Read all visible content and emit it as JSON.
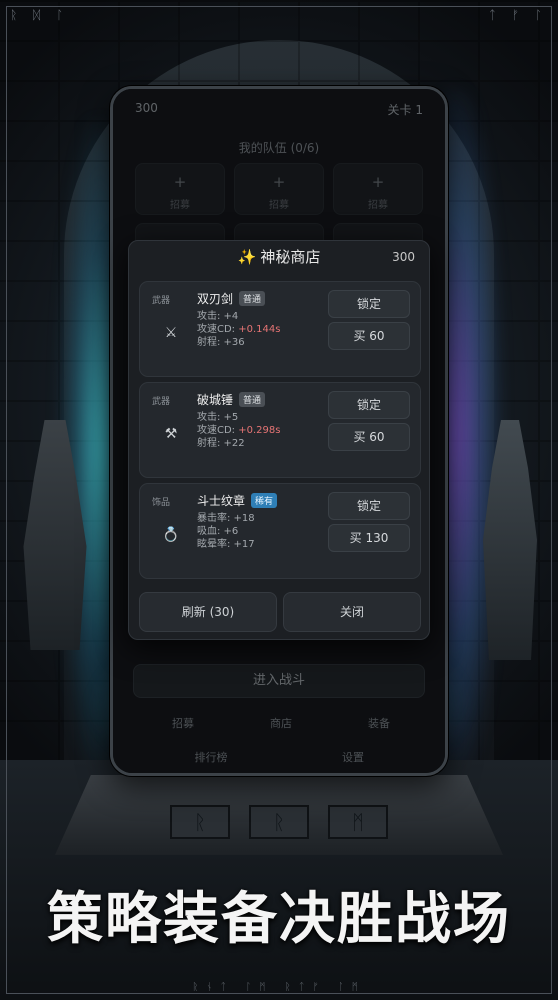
{
  "header": {
    "gold": "300",
    "level": "关卡 1"
  },
  "team": {
    "title": "我的队伍 (0/6)",
    "slots": [
      {
        "plus": "+",
        "label": "招募"
      },
      {
        "plus": "+",
        "label": "招募"
      },
      {
        "plus": "+",
        "label": "招募"
      }
    ]
  },
  "shop": {
    "spark_icon": "✨",
    "title": "神秘商店",
    "gold": "300",
    "items": [
      {
        "kind": "武器",
        "icon": "crossed-swords-icon",
        "glyph": "⚔",
        "name": "双刃剑",
        "rarity": "普通",
        "stat1": "攻击: +4",
        "stat2_prefix": "攻速CD: ",
        "stat2_value": "+0.144s",
        "stat3": "射程: +36",
        "lock_label": "锁定",
        "buy_label": "买 60"
      },
      {
        "kind": "武器",
        "icon": "crossed-hammers-icon",
        "glyph": "⚒",
        "name": "破城锤",
        "rarity": "普通",
        "stat1": "攻击: +5",
        "stat2_prefix": "攻速CD: ",
        "stat2_value": "+0.298s",
        "stat3": "射程: +22",
        "lock_label": "锁定",
        "buy_label": "买 60"
      },
      {
        "kind": "饰品",
        "icon": "ring-icon",
        "glyph": "💍",
        "name": "斗士纹章",
        "rarity": "稀有",
        "stat1": "暴击率: +18",
        "stat2": "吸血: +6",
        "stat3": "眩晕率: +17",
        "lock_label": "锁定",
        "buy_label": "买 130"
      }
    ],
    "refresh_label": "刷新 (30)",
    "close_label": "关闭"
  },
  "enter_battle": "进入战斗",
  "bottom_nav": [
    "招募",
    "商店",
    "装备",
    "排行榜",
    "设置"
  ],
  "slogan": "策略装备决胜战场",
  "colors": {
    "accent_rare": "#2f7fb6",
    "negative_stat": "#e57474",
    "spark": "#f2c94c"
  }
}
